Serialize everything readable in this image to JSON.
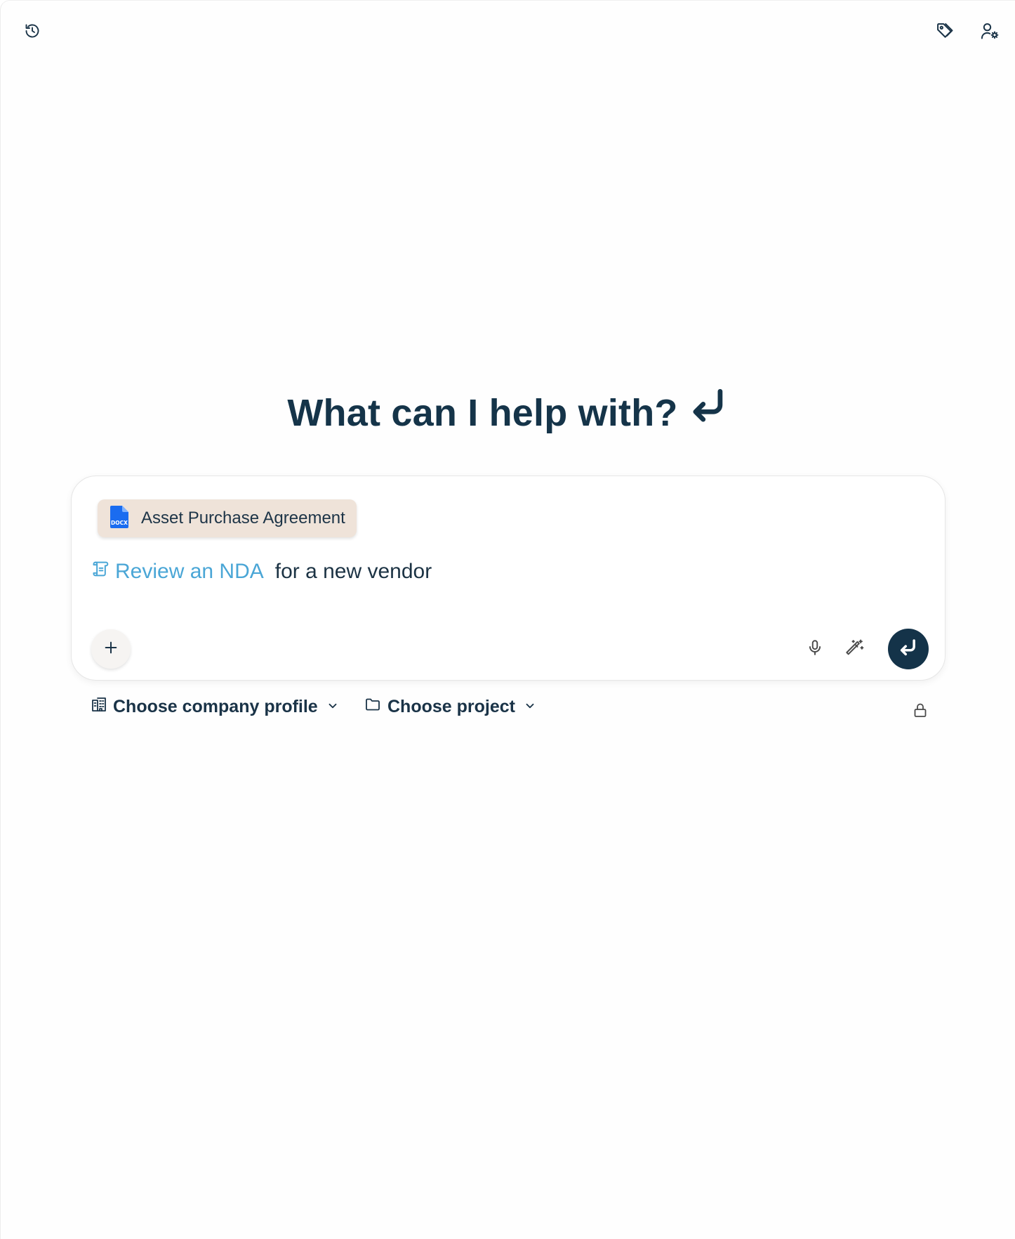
{
  "header": {
    "history_icon": "history-icon",
    "tag_icon": "tag-icon",
    "user_settings_icon": "user-gear-icon"
  },
  "headline": {
    "text": "What can I help with?",
    "icon": "enter-arrow-icon"
  },
  "composer": {
    "attachment": {
      "label": "Asset Purchase Agreement",
      "file_type": "DOCX",
      "icon": "docx-file-icon"
    },
    "template_link": {
      "label": "Review an NDA",
      "icon": "scroll-icon"
    },
    "prompt_text": "for a new vendor",
    "add_icon": "plus-icon",
    "mic_icon": "microphone-icon",
    "magic_icon": "magic-wand-icon",
    "send_icon": "enter-arrow-icon"
  },
  "footer_controls": {
    "company_profile": {
      "label": "Choose company profile",
      "icon": "building-icon"
    },
    "project": {
      "label": "Choose project",
      "icon": "folder-icon"
    },
    "lock_icon": "lock-icon"
  },
  "colors": {
    "primary_dark": "#143349",
    "link_blue": "#4aa6d6",
    "chip_background": "#efe3d9",
    "docx_blue": "#1a6cf0"
  }
}
